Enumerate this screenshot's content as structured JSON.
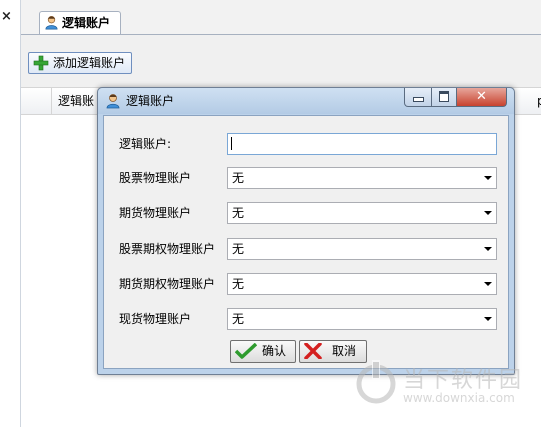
{
  "left_strip": {
    "close_glyph": "×"
  },
  "tab": {
    "label": "逻辑账户",
    "icon": "user-icon"
  },
  "toolbar": {
    "add_label": "添加逻辑账户",
    "add_icon": "plus-icon"
  },
  "grid": {
    "columns": [
      "逻辑账",
      "",
      "",
      "",
      "",
      "",
      "p"
    ]
  },
  "dialog": {
    "title": "逻辑账户",
    "icon": "user-icon",
    "fields": [
      {
        "label": "逻辑账户:",
        "type": "text",
        "value": ""
      },
      {
        "label": "股票物理账户",
        "type": "select",
        "value": "无"
      },
      {
        "label": "期货物理账户",
        "type": "select",
        "value": "无"
      },
      {
        "label": "股票期权物理账户",
        "type": "select",
        "value": "无"
      },
      {
        "label": "期货期权物理账户",
        "type": "select",
        "value": "无"
      },
      {
        "label": "现货物理账户",
        "type": "select",
        "value": "无"
      }
    ],
    "ok_label": "确认",
    "cancel_label": "取消",
    "ok_icon": "check-icon",
    "cancel_icon": "x-icon"
  },
  "watermark": {
    "title": "当下软件园",
    "url": "www.downxia.com"
  },
  "colors": {
    "dialog_frame": "#bcd2ea",
    "close_button": "#c8422f",
    "check": "#2e9b2e",
    "cross": "#d42020"
  }
}
